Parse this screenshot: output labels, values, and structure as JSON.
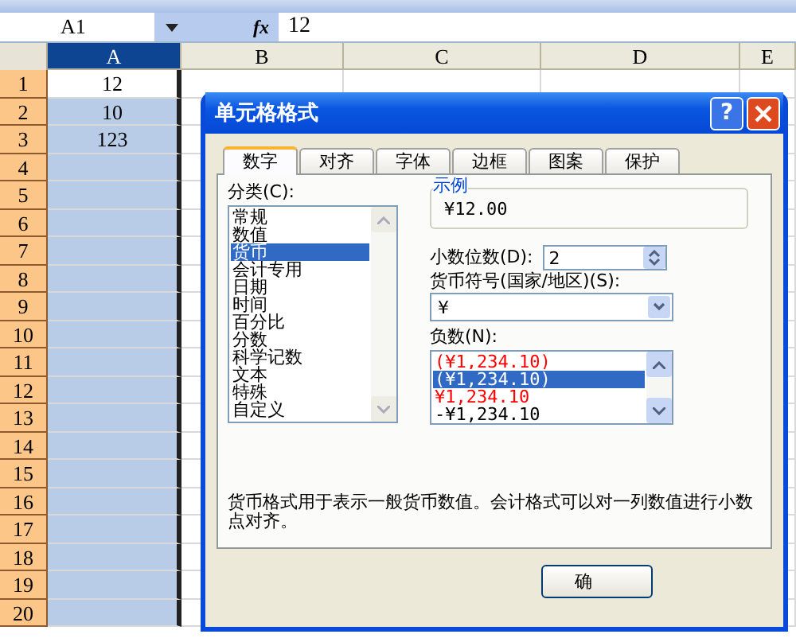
{
  "formula_bar": {
    "name_box": "A1",
    "fx": "fx",
    "value": "12"
  },
  "columns": [
    {
      "label": "A",
      "selected": true
    },
    {
      "label": "B",
      "selected": false
    },
    {
      "label": "C",
      "selected": false
    },
    {
      "label": "D",
      "selected": false
    },
    {
      "label": "E",
      "selected": false
    }
  ],
  "rows": [
    {
      "label": "1",
      "selected": true,
      "active": true,
      "value": "12"
    },
    {
      "label": "2",
      "selected": true,
      "active": false,
      "value": "10"
    },
    {
      "label": "3",
      "selected": true,
      "active": false,
      "value": "123"
    },
    {
      "label": "4",
      "selected": true,
      "active": false
    },
    {
      "label": "5",
      "selected": true,
      "active": false
    },
    {
      "label": "6",
      "selected": true,
      "active": false
    },
    {
      "label": "7",
      "selected": true,
      "active": false
    },
    {
      "label": "8",
      "selected": true,
      "active": false
    },
    {
      "label": "9",
      "selected": true,
      "active": false
    },
    {
      "label": "10",
      "selected": true,
      "active": false
    },
    {
      "label": "11",
      "selected": true,
      "active": false
    },
    {
      "label": "12",
      "selected": true,
      "active": false
    },
    {
      "label": "13",
      "selected": true,
      "active": false
    },
    {
      "label": "14",
      "selected": true,
      "active": false
    },
    {
      "label": "15",
      "selected": true,
      "active": false
    },
    {
      "label": "16",
      "selected": true,
      "active": false
    },
    {
      "label": "17",
      "selected": true,
      "active": false
    },
    {
      "label": "18",
      "selected": true,
      "active": false
    },
    {
      "label": "19",
      "selected": true,
      "active": false
    },
    {
      "label": "20",
      "selected": true,
      "active": false
    }
  ],
  "dialog": {
    "title": "单元格格式",
    "help": "?",
    "tabs": [
      {
        "label": "数字",
        "selected": true
      },
      {
        "label": "对齐",
        "selected": false
      },
      {
        "label": "字体",
        "selected": false
      },
      {
        "label": "边框",
        "selected": false
      },
      {
        "label": "图案",
        "selected": false
      },
      {
        "label": "保护",
        "selected": false
      }
    ],
    "category_label": "分类(C):",
    "categories": [
      {
        "label": "常规",
        "selected": false
      },
      {
        "label": "数值",
        "selected": false
      },
      {
        "label": "货币",
        "selected": true
      },
      {
        "label": "会计专用",
        "selected": false
      },
      {
        "label": "日期",
        "selected": false
      },
      {
        "label": "时间",
        "selected": false
      },
      {
        "label": "百分比",
        "selected": false
      },
      {
        "label": "分数",
        "selected": false
      },
      {
        "label": "科学记数",
        "selected": false
      },
      {
        "label": "文本",
        "selected": false
      },
      {
        "label": "特殊",
        "selected": false
      },
      {
        "label": "自定义",
        "selected": false
      }
    ],
    "sample_label": "示例",
    "sample_value": "¥12.00",
    "decimals_label": "小数位数(D):",
    "decimals": "2",
    "symbol_label": "货币符号(国家/地区)(S):",
    "symbol": "¥",
    "negative_label": "负数(N):",
    "negatives": [
      {
        "text": "(¥1,234.10)",
        "color": "#ff0000",
        "selected": false
      },
      {
        "text": "(¥1,234.10)",
        "selected": true
      },
      {
        "text": "¥1,234.10",
        "color": "#ff0000",
        "selected": false
      },
      {
        "text": "-¥1,234.10",
        "color": "#000000",
        "selected": false
      }
    ],
    "description": "货币格式用于表示一般货币数值。会计格式可以对一列数值进行小数点对齐。",
    "buttons": [
      "确"
    ]
  }
}
